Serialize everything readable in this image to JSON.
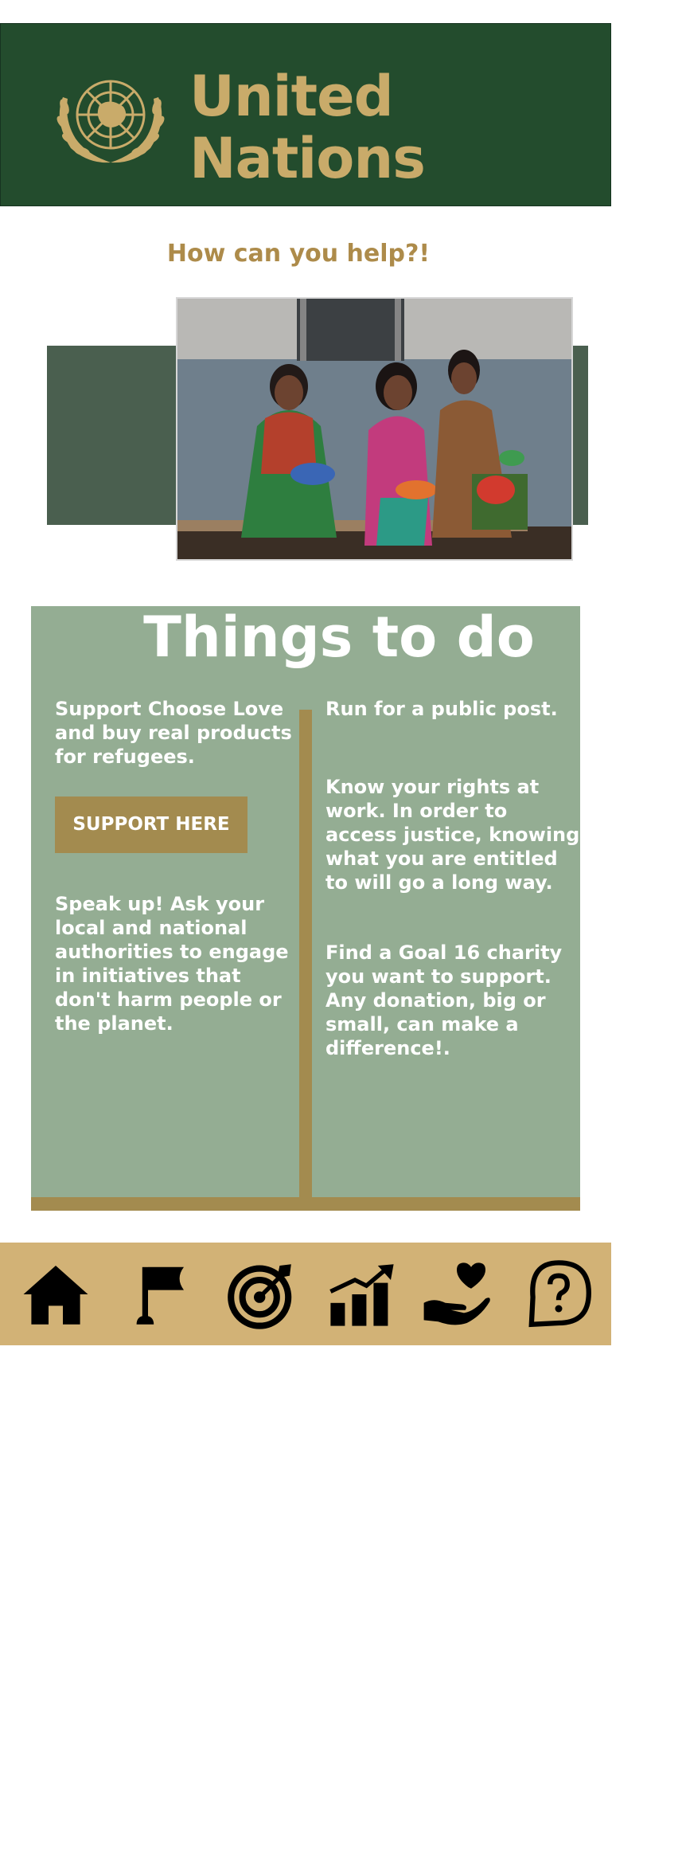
{
  "header": {
    "logo_icon": "un-emblem-icon",
    "title_line1": "United",
    "title_line2": "Nations"
  },
  "help": {
    "title": "How can you help?!"
  },
  "photo": {
    "icon": "photo-women-with-babies"
  },
  "things_to_do": {
    "title": "Things to do",
    "left": [
      "Support Choose Love and buy real products for refugees.",
      "Speak up! Ask your local and national authorities to engage in initiatives that don't harm people or the planet."
    ],
    "button_label": "SUPPORT HERE",
    "right": [
      "Run for a public post.",
      "Know your rights at work. In order to access justice, knowing what you are entitled to will go a long way.",
      "Find a Goal 16 charity you want to support. Any donation, big or small, can make a difference!."
    ]
  },
  "nav": {
    "items": [
      {
        "icon": "home-icon"
      },
      {
        "icon": "flag-icon"
      },
      {
        "icon": "target-icon"
      },
      {
        "icon": "growth-chart-icon"
      },
      {
        "icon": "heart-hand-icon"
      },
      {
        "icon": "question-icon"
      }
    ]
  },
  "colors": {
    "header_bg": "#234c2d",
    "gold": "#c9ab6a",
    "accent_gold": "#a38b4f",
    "sage": "#94ad93",
    "nav_bg": "#d2b276"
  }
}
